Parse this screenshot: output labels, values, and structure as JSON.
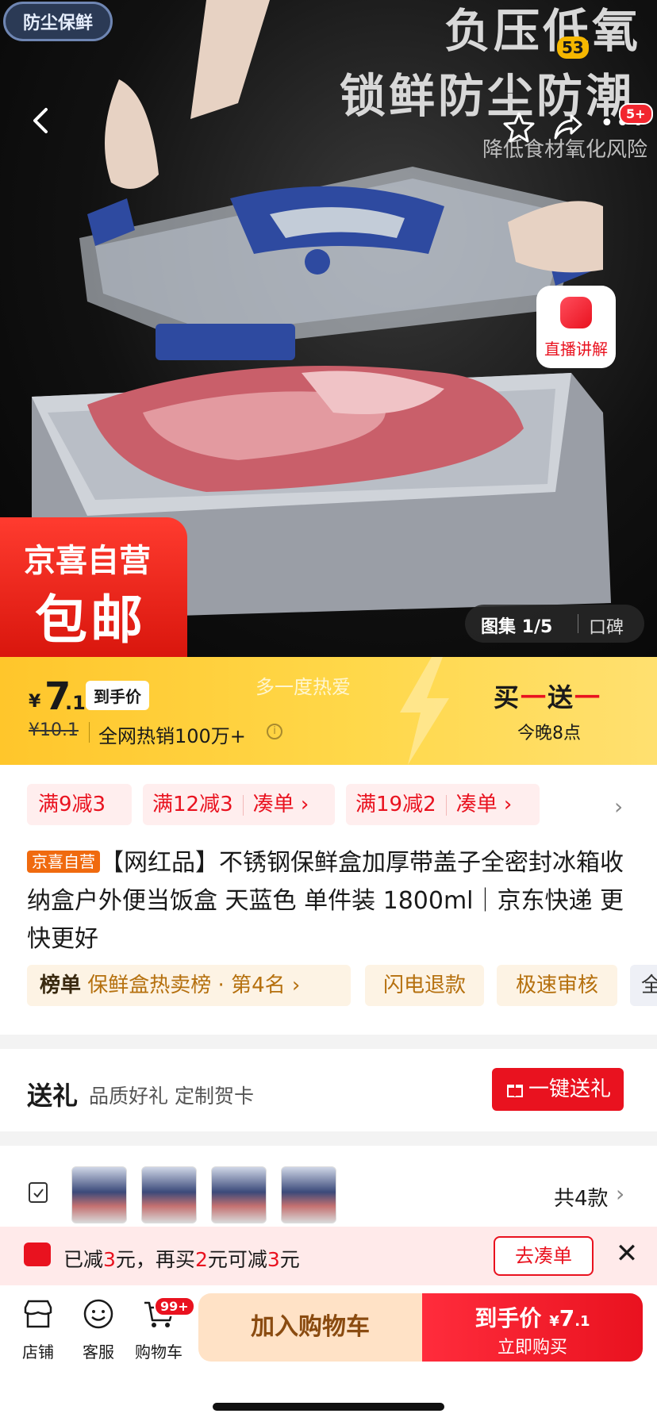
{
  "hero": {
    "badge": "防尘保鲜",
    "headline1": "负压低氧",
    "headline2": "锁鲜防尘防潮",
    "subline": "降低食材氧化风险",
    "top_badge": "53",
    "more_badge": "5+",
    "live_label": "直播讲解",
    "promo_line1": "京喜自营",
    "promo_line2": "包邮",
    "gallery_label": "图集 1/5",
    "review_tab": "口碑"
  },
  "price": {
    "yen": "¥",
    "integer": "7",
    "decimal": ".1",
    "tag": "到手价",
    "original": "¥10.1",
    "hot_sales": "全网热销100万+",
    "slogan": "多一度热爱",
    "bogo_buy": "买",
    "bogo_get": "送",
    "bogo_dash": "一",
    "bogo_time": "今晚8点"
  },
  "coupons": [
    {
      "label": "满9减3"
    },
    {
      "label": "满12减3",
      "action": "凑单 ›"
    },
    {
      "label": "满19减2",
      "action": "凑单 ›"
    }
  ],
  "title": {
    "tag": "京喜自营",
    "text": "【网红品】不锈钢保鲜盒加厚带盖子全密封冰箱收纳盒户外便当饭盒 天蓝色 单件装 1800ml｜京东快递 更快更好"
  },
  "chips": {
    "rank_prefix": "榜单",
    "rank_text": "保鲜盒热卖榜 · 第4名 ›",
    "refund": "闪电退款",
    "audit": "极速审核",
    "cut": "全"
  },
  "gift": {
    "title": "送礼",
    "desc": "品质好礼 定制贺卡",
    "button": "一键送礼"
  },
  "variants": {
    "count": "共4款",
    "thumbs": [
      "thumb-1",
      "thumb-2",
      "thumb-3",
      "thumb-4"
    ]
  },
  "discount": {
    "p1": "已减",
    "v1": "3",
    "p2": "元，再买",
    "v2": "2",
    "p3": "元可减",
    "v3": "3",
    "p4": "元",
    "button": "去凑单"
  },
  "bottom": {
    "store": "店铺",
    "service": "客服",
    "cart": "购物车",
    "cart_badge": "99+",
    "add_cart": "加入购物车",
    "buy_price_label": "到手价",
    "buy_price_yen": "¥",
    "buy_price_int": "7",
    "buy_price_dec": ".1",
    "buy_now": "立即购买"
  },
  "colors": {
    "accent_red": "#e9121f",
    "price_yellow": "#ffc62b",
    "chip_orange": "#b5700e",
    "cart_bg": "#ffe2c6"
  }
}
